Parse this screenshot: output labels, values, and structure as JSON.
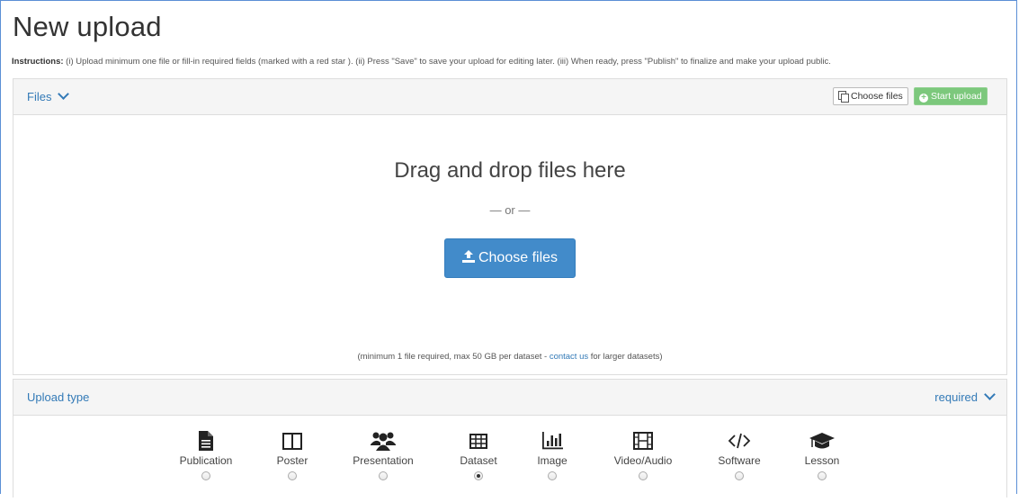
{
  "page": {
    "title": "New upload",
    "instructions_label": "Instructions:",
    "instructions_text": "(i) Upload minimum one file or fill-in required fields (marked with a red star ). (ii) Press \"Save\" to save your upload for editing later. (iii) When ready, press \"Publish\" to finalize and make your upload public."
  },
  "files": {
    "heading": "Files",
    "choose_small": "Choose files",
    "start_upload": "Start upload",
    "drop_text": "Drag and drop files here",
    "or_text": "— or —",
    "choose_button": "Choose files",
    "note_before": "(minimum 1 file required, max 50 GB per dataset - ",
    "note_link": "contact us",
    "note_after": " for larger datasets)"
  },
  "upload_type": {
    "heading": "Upload type",
    "required": "required",
    "selected": "Dataset",
    "types": [
      {
        "label": "Publication",
        "icon": "file-text-icon"
      },
      {
        "label": "Poster",
        "icon": "columns-icon"
      },
      {
        "label": "Presentation",
        "icon": "group-icon"
      },
      {
        "label": "Dataset",
        "icon": "table-icon"
      },
      {
        "label": "Image",
        "icon": "bar-chart-icon"
      },
      {
        "label": "Video/Audio",
        "icon": "film-icon"
      },
      {
        "label": "Software",
        "icon": "code-icon"
      },
      {
        "label": "Lesson",
        "icon": "graduation-cap-icon"
      }
    ]
  },
  "colors": {
    "accent": "#337ab7",
    "primary_button": "#428bca",
    "success_button": "#7cc87c"
  }
}
